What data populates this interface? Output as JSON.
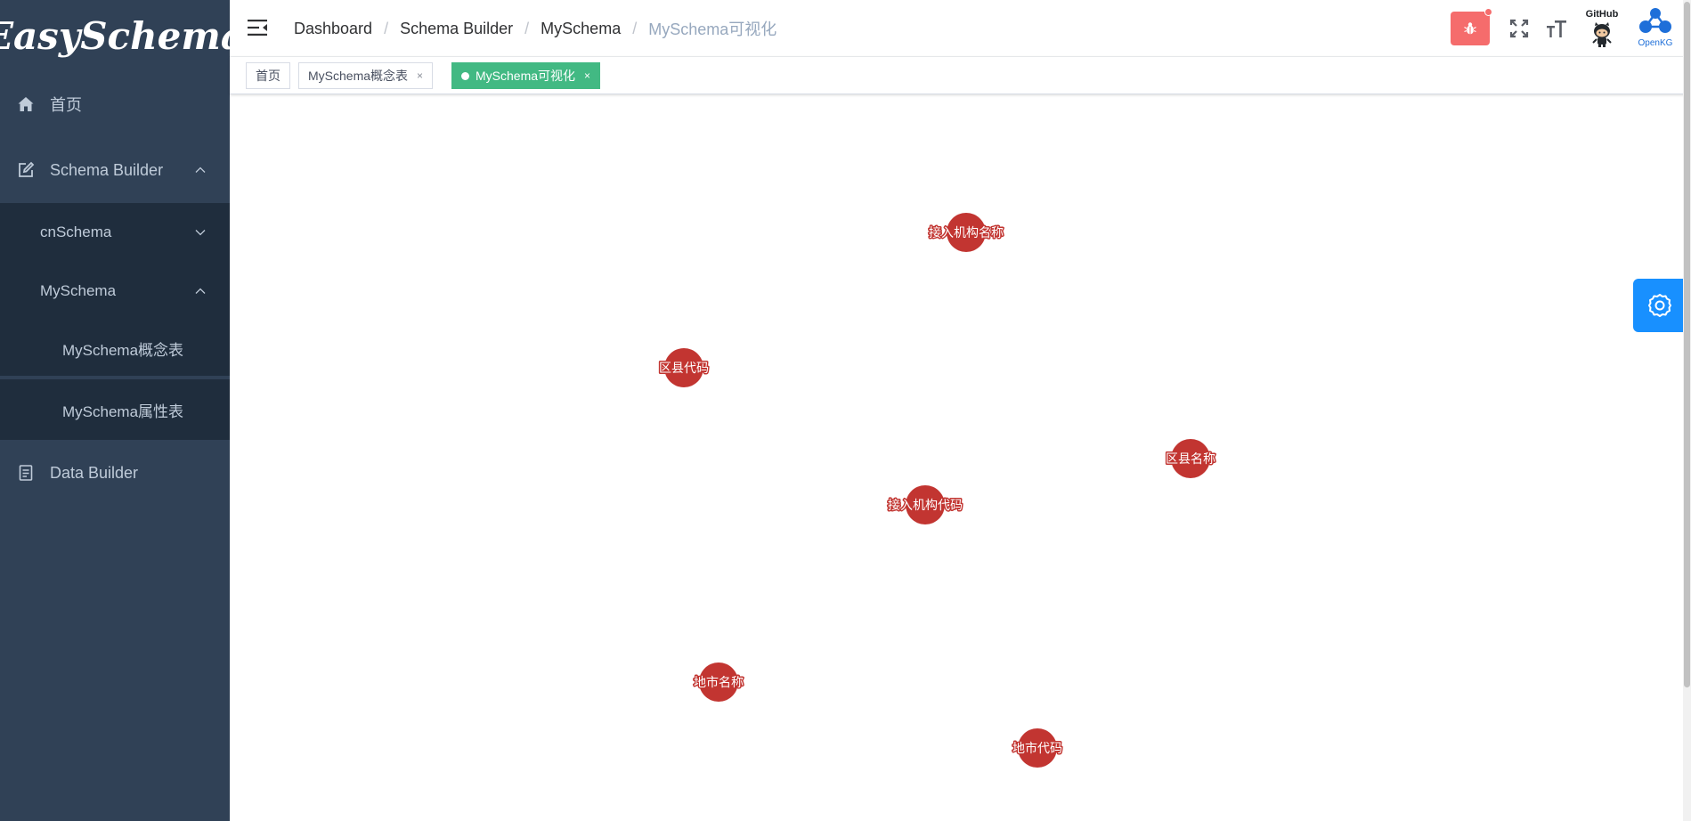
{
  "sidebar": {
    "logo": "EasySchema",
    "items": [
      {
        "label": "首页",
        "icon": "home-icon"
      },
      {
        "label": "Schema Builder",
        "icon": "edit-icon"
      },
      {
        "label": "cnSchema"
      },
      {
        "label": "MySchema"
      },
      {
        "label": "MySchema概念表"
      },
      {
        "label": "MySchema属性表"
      },
      {
        "label": "Data Builder",
        "icon": "document-icon"
      }
    ]
  },
  "navbar": {
    "breadcrumb": [
      "Dashboard",
      "Schema Builder",
      "MySchema",
      "MySchema可视化"
    ],
    "separator": "/",
    "github_label": "GitHub",
    "openkg_label": "OpenKG"
  },
  "tags": [
    {
      "label": "首页",
      "closable": false,
      "active": false
    },
    {
      "label": "MySchema概念表",
      "closable": true,
      "active": false
    },
    {
      "label": "MySchema可视化",
      "closable": true,
      "active": true
    }
  ],
  "tag_close_glyph": "×",
  "graph": {
    "node_color": "#c23531",
    "nodes": [
      {
        "label": "接入机构名称"
      },
      {
        "label": "区县代码"
      },
      {
        "label": "区县名称"
      },
      {
        "label": "接入机构代码"
      },
      {
        "label": "地市名称"
      },
      {
        "label": "地市代码"
      }
    ]
  },
  "colors": {
    "sidebar_bg": "#304156",
    "submenu_bg": "#1f2d3d",
    "active_tag": "#42b983",
    "bug_button": "#f56c6c",
    "settings_button": "#1890ff"
  }
}
